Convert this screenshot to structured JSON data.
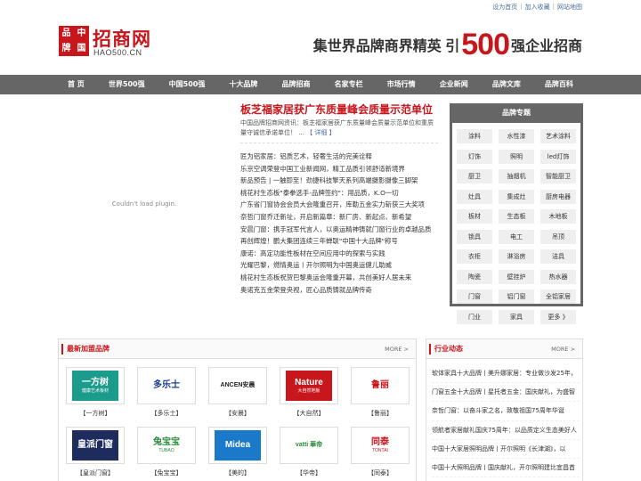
{
  "top_links": [
    "设为首页",
    "加入收藏",
    "网站地图"
  ],
  "logo": {
    "chars": [
      "品",
      "中",
      "牌",
      "国"
    ],
    "main": "招商网",
    "sub": "HAO500.CN"
  },
  "slogan": {
    "left": "集世界品牌商界精英 引",
    "number": "500",
    "right": "强企业招商"
  },
  "nav": [
    "首 页",
    "世界500强",
    "中国500强",
    "十大品牌",
    "品牌招商",
    "名家专栏",
    "市场行情",
    "企业新闻",
    "品牌文库",
    "品牌百科"
  ],
  "plugin_text": "Couldn't load plugin.",
  "headline": "板芝福家居获广东质量峰会质量示范单位",
  "summary": {
    "text": "中国品牌招商网资讯：板芝福家居获广东质量峰会质量示范单位和重质量守诚信承诺单位！ ...",
    "more": "【 详细 】"
  },
  "news": [
    "匠为铝家居：铝质艺术，轻奢生活的完美诠释",
    "乐京空调荣登中国工业新闻网，精工品质引领舒适新境界",
    "新品预告 | 一触即至！劲捷科技擎天系列高端摄影摄像三脚架",
    "桃花村生态板\"泰拳选手-品牌签约\"：用品质，K.O一切",
    "广东省门窗协会会员大会隆重召开，库勒五金实力斩获三大奖项",
    "奈哲门窗乔迁新址，开启新篇章：新厂房、新起点、新希望",
    "安晨门窗：携手冠军代言人，以奥运精神铸就门窗行业的卓越品质",
    "再创辉煌！鹏大集团连续三年蝉联\"中国十大品牌\"称号",
    "康诺：高定功能性板材在空间应用中的探索与实践",
    "光耀巴黎，燃情奥运丨开尔照明为中国奥运健儿助威",
    "桃花村生态板祝贺巴黎奥运会隆重开幕，共创美好人居未来",
    "奥诺克五金荣登央视，匠心品质铸就品牌传奇"
  ],
  "brand_panel": {
    "title": "品牌专题",
    "tags": [
      "涂料",
      "水性漆",
      "艺术涂料",
      "灯饰",
      "照明",
      "led灯饰",
      "厨卫",
      "抽烟机",
      "智能厨卫",
      "灶具",
      "集成灶",
      "厨房电器",
      "板材",
      "生态板",
      "木地板",
      "锁具",
      "电工",
      "吊顶",
      "衣柜",
      "淋浴房",
      "洁具",
      "陶瓷",
      "壁挂炉",
      "热水器",
      "门窗",
      "铝门窗",
      "全铝家居",
      "门业",
      "家具",
      "更多 》"
    ]
  },
  "new_brands": {
    "title": "最新加盟品牌",
    "more": "MORE >",
    "items": [
      {
        "name": "【一方树】",
        "logo_text": "一方树",
        "logo_sub": "健康艺术板材",
        "bg": "#1a9b8c",
        "fg": "#ffffff"
      },
      {
        "name": "【多乐士】",
        "logo_text": "多乐士",
        "logo_sub": "",
        "bg": "#ffffff",
        "fg": "#1a3e8c"
      },
      {
        "name": "【安晨】",
        "logo_text": "ANCEN安晨",
        "logo_sub": "",
        "bg": "#ffffff",
        "fg": "#222222"
      },
      {
        "name": "【大自然】",
        "logo_text": "Nature",
        "logo_sub": "大自然地板",
        "bg": "#c8161d",
        "fg": "#ffffff"
      },
      {
        "name": "【鲁丽】",
        "logo_text": "鲁丽",
        "logo_sub": "",
        "bg": "#ffffff",
        "fg": "#c8161d"
      },
      {
        "name": "【皇派门窗】",
        "logo_text": "皇派门窗",
        "logo_sub": "",
        "bg": "#1d2c5c",
        "fg": "#ffffff"
      },
      {
        "name": "【兔宝宝】",
        "logo_text": "兔宝宝",
        "logo_sub": "TUBAO",
        "bg": "#ffffff",
        "fg": "#2a8a3c"
      },
      {
        "name": "【美的】",
        "logo_text": "Midea",
        "logo_sub": "",
        "bg": "#1a7ac9",
        "fg": "#ffffff"
      },
      {
        "name": "【华帝】",
        "logo_text": "vatti 華帝",
        "logo_sub": "",
        "bg": "#ffffff",
        "fg": "#2a8a3c"
      },
      {
        "name": "【同泰】",
        "logo_text": "同泰",
        "logo_sub": "TONTAI",
        "bg": "#ffffff",
        "fg": "#c8161d"
      }
    ]
  },
  "industry": {
    "title": "行业动态",
    "more": "MORE >",
    "items": [
      "软体家具十大品牌丨美升娜家居：专业做沙发25年，",
      "门窗五金十大品牌丨星托者五金：国庆献礼，为盛智",
      "奈哲门窗：以奋斗家之名，致敬祖国75周年华诞",
      "领航者家居献礼国庆75周年：以品质定义生态美好人",
      "中国十大家居照明品牌丨开尔照明《长津湖》，以",
      "中国十大照明品牌丨国庆献礼，开尔照明建比宜昌首",
      "康丽莱家居携手吉美国庆生态床垫：回归自然睡眠，拥抱"
    ]
  }
}
